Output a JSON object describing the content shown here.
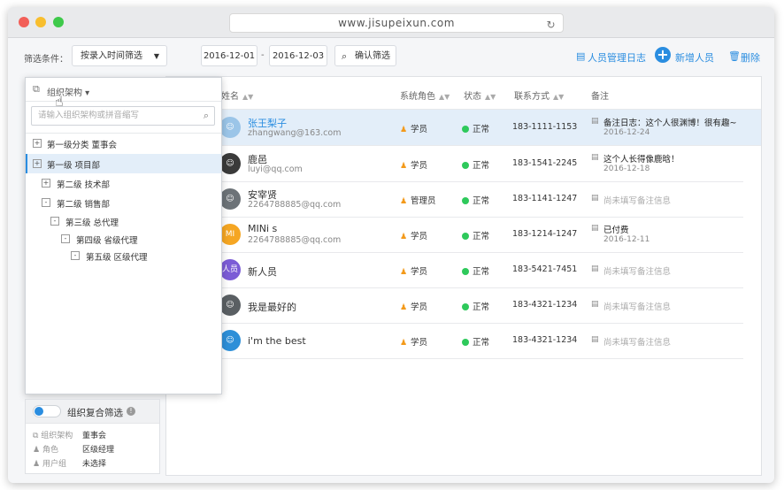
{
  "browser": {
    "url": "www.jisupeixun.com"
  },
  "filter": {
    "label": "筛选条件：",
    "select_value": "按录入时间筛选",
    "date_from": "2016-12-01",
    "date_sep": "-",
    "date_to": "2016-12-03",
    "confirm_label": "确认筛选"
  },
  "actions": {
    "log_label": "人员管理日志",
    "add_label": "新增人员",
    "delete_label": "删除"
  },
  "table": {
    "headers": {
      "name": "姓名",
      "role": "系统角色",
      "status": "状态",
      "contact": "联系方式",
      "note": "备注"
    },
    "rows": [
      {
        "name": "张王梨子",
        "email": "zhangwang@163.com",
        "role": "学员",
        "status": "正常",
        "phone": "183-1111-1153",
        "note": "备注日志：这个人很渊博！很有趣~",
        "note_date": "2016-12-24"
      },
      {
        "name": "鹿邑",
        "email": "luyi@qq.com",
        "role": "学员",
        "status": "正常",
        "phone": "183-1541-2245",
        "note": "这个人长得像鹿晗！",
        "note_date": "2016-12-18"
      },
      {
        "name": "安宰贤",
        "email": "2264788885@qq.com",
        "role": "管理员",
        "status": "正常",
        "phone": "183-1141-1247",
        "note": "尚未填写备注信息",
        "note_date": ""
      },
      {
        "name": "MINi s",
        "email": "2264788885@qq.com",
        "role": "学员",
        "status": "正常",
        "phone": "183-1214-1247",
        "note": "已付费",
        "note_date": "2016-12-11",
        "avatar_text": "MI"
      },
      {
        "name": "新人员",
        "email": "",
        "role": "学员",
        "status": "正常",
        "phone": "183-5421-7451",
        "note": "尚未填写备注信息",
        "note_date": "",
        "avatar_text": "人员"
      },
      {
        "name": "我是最好的",
        "email": "",
        "role": "学员",
        "status": "正常",
        "phone": "183-4321-1234",
        "note": "尚未填写备注信息",
        "note_date": ""
      },
      {
        "name": "i'm the best",
        "email": "",
        "role": "学员",
        "status": "正常",
        "phone": "183-4321-1234",
        "note": "尚未填写备注信息",
        "note_date": ""
      }
    ]
  },
  "org_dropdown": {
    "title": "组织架构",
    "search_placeholder": "请输入组织架构或拼音缩写",
    "items": [
      {
        "label": "第一级分类 董事会",
        "toggle": "+"
      },
      {
        "label": "第一级 项目部",
        "toggle": "+"
      },
      {
        "label": "第二级 技术部",
        "toggle": "+"
      },
      {
        "label": "第二级 销售部",
        "toggle": "-"
      },
      {
        "label": "第三级 总代理",
        "toggle": "-"
      },
      {
        "label": "第四级 省级代理",
        "toggle": "-"
      },
      {
        "label": "第五级 区级代理",
        "toggle": "-"
      }
    ]
  },
  "composite_filter": {
    "title": "组织复合筛选",
    "lines": [
      {
        "label": "组织架构",
        "value": "董事会"
      },
      {
        "label": "角色",
        "value": "区级经理"
      },
      {
        "label": "用户组",
        "value": "未选择"
      }
    ]
  },
  "colors": {
    "accent": "#2a8de0",
    "status_ok": "#2ec95b",
    "role_icon": "#f39a1b"
  }
}
